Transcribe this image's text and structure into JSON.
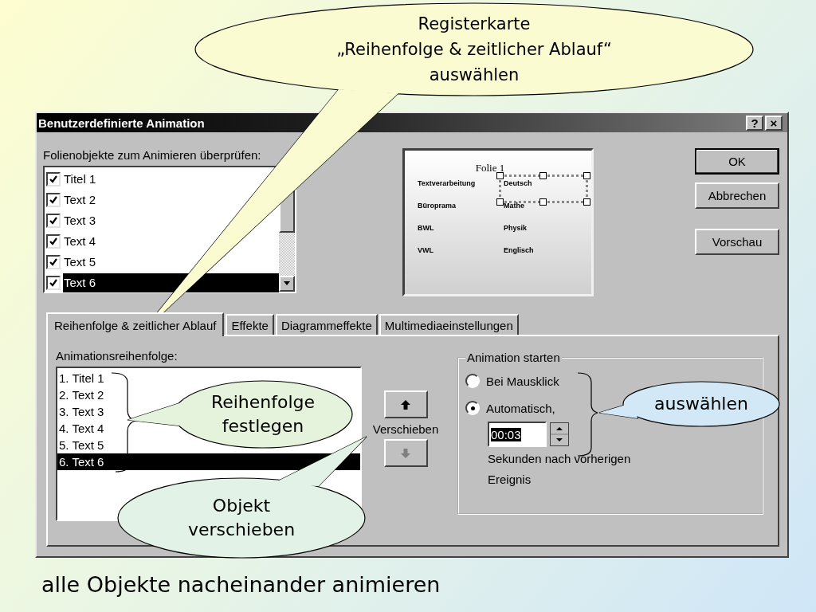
{
  "callouts": [
    {
      "text": "Registerkarte\n„Reihenfolge & zeitlicher Ablauf“\nauswählen"
    },
    {
      "text": "Reihenfolge\nfestlegen"
    },
    {
      "text": "Objekt\nverschieben"
    },
    {
      "text": "auswählen"
    }
  ],
  "dialog": {
    "title": "Benutzerdefinierte Animation",
    "title_buttons": [
      "?",
      "×"
    ],
    "objects_label": "Folienobjekte zum Animieren überprüfen:",
    "objects": [
      {
        "label": "Titel 1",
        "checked": true,
        "selected": false
      },
      {
        "label": "Text 2",
        "checked": true,
        "selected": false
      },
      {
        "label": "Text 3",
        "checked": true,
        "selected": false
      },
      {
        "label": "Text 4",
        "checked": true,
        "selected": false
      },
      {
        "label": "Text 5",
        "checked": true,
        "selected": false
      },
      {
        "label": "Text 6",
        "checked": true,
        "selected": true
      }
    ],
    "preview": {
      "title": "Folie 1",
      "rows": [
        {
          "left": "Textverarbeitung",
          "right": "Deutsch"
        },
        {
          "left": "Büroprama",
          "right": "Mathe"
        },
        {
          "left": "BWL",
          "right": "Physik"
        },
        {
          "left": "VWL",
          "right": "Englisch"
        }
      ]
    },
    "buttons": [
      "OK",
      "Abbrechen",
      "Vorschau"
    ],
    "tabs": [
      {
        "label": "Reihenfolge & zeitlicher Ablauf",
        "selected": true
      },
      {
        "label": "Effekte",
        "selected": false
      },
      {
        "label": "Diagrammeffekte",
        "selected": false
      },
      {
        "label": "Multimediaeinstellungen",
        "selected": false
      }
    ],
    "order_label": "Animationsreihenfolge:",
    "order": [
      {
        "label": "1. Titel 1",
        "selected": false
      },
      {
        "label": "2. Text 2",
        "selected": false
      },
      {
        "label": "3. Text 3",
        "selected": false
      },
      {
        "label": "4. Text 4",
        "selected": false
      },
      {
        "label": "5. Text 5",
        "selected": false
      },
      {
        "label": "6. Text 6",
        "selected": true
      }
    ],
    "move_label": "Verschieben",
    "move_buttons": [
      {
        "kind": "up",
        "disabled": false
      },
      {
        "kind": "down",
        "disabled": true
      }
    ],
    "start": {
      "title": "Animation starten",
      "options": [
        {
          "label": "Bei Mausklick",
          "selected": false
        },
        {
          "label": "Automatisch,",
          "selected": true
        }
      ],
      "time": "00:03",
      "note": "Sekunden nach vorherigen Ereignis"
    }
  },
  "caption": "alle Objekte nacheinander animieren"
}
